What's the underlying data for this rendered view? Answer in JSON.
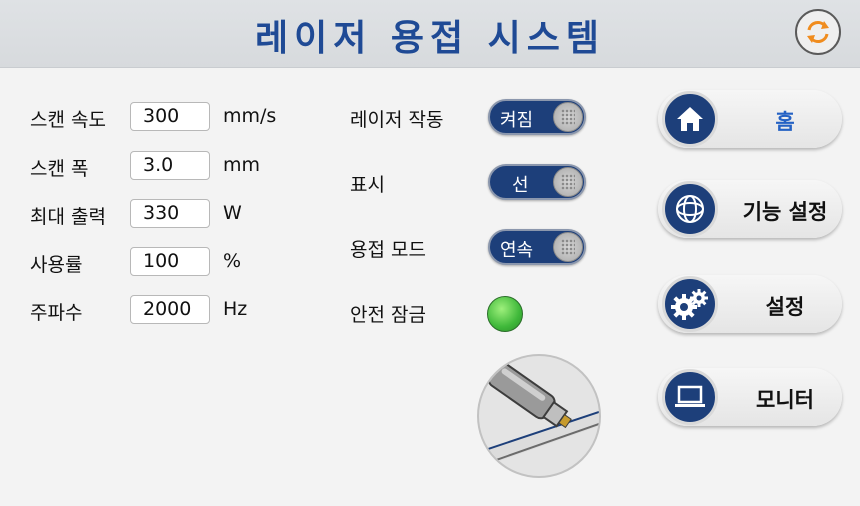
{
  "header": {
    "title": "레이저 용접 시스템"
  },
  "params": [
    {
      "label": "스캔 속도",
      "value": "300",
      "unit": "mm/s"
    },
    {
      "label": "스캔 폭",
      "value": "3.0",
      "unit": "mm"
    },
    {
      "label": "최대 출력",
      "value": "330",
      "unit": "W"
    },
    {
      "label": "사용률",
      "value": "100",
      "unit": "%"
    },
    {
      "label": "주파수",
      "value": "2000",
      "unit": "Hz"
    }
  ],
  "controls": {
    "laser": {
      "label": "레이저 작동",
      "state": "켜짐"
    },
    "indicator": {
      "label": "표시",
      "state": "선"
    },
    "weld_mode": {
      "label": "용접 모드",
      "state": "연속"
    },
    "safety_lock": {
      "label": "안전 잠금",
      "status_color": "#3fb83a"
    }
  },
  "nav": {
    "home": "홈",
    "function_settings": "기능 설정",
    "settings": "설정",
    "monitor": "모니터"
  },
  "colors": {
    "accent": "#1f4a95",
    "active": "#2562c4",
    "ok": "#3fb83a",
    "refresh": "#f08c1e"
  }
}
